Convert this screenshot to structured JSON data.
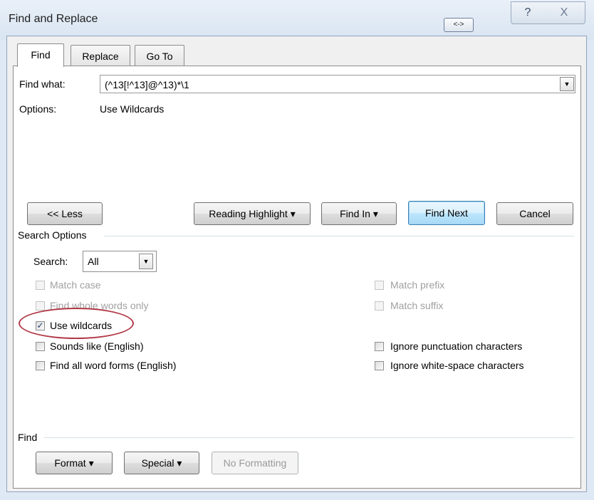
{
  "window": {
    "title": "Find and Replace",
    "keyboard_button": "<->",
    "help_icon": "?",
    "close_icon": "X"
  },
  "tabs": [
    {
      "label": "Find",
      "active": true
    },
    {
      "label": "Replace",
      "active": false
    },
    {
      "label": "Go To",
      "active": false
    }
  ],
  "find_what": {
    "label": "Find what:",
    "value": "(^13[!^13]@^13)*\\1"
  },
  "options_summary": {
    "label": "Options:",
    "value": "Use Wildcards"
  },
  "buttons": {
    "less": "<< Less",
    "reading_highlight": "Reading Highlight",
    "find_in": "Find In",
    "find_next": "Find Next",
    "cancel": "Cancel"
  },
  "search_options": {
    "header": "Search Options",
    "search_label": "Search:",
    "search_value": "All",
    "checkboxes_left": [
      {
        "label": "Match case",
        "checked": false,
        "enabled": false
      },
      {
        "label": "Find whole words only",
        "checked": false,
        "enabled": false
      },
      {
        "label": "Use wildcards",
        "checked": true,
        "enabled": true
      },
      {
        "label": "Sounds like (English)",
        "checked": false,
        "enabled": true
      },
      {
        "label": "Find all word forms (English)",
        "checked": false,
        "enabled": true
      }
    ],
    "checkboxes_right": [
      {
        "label": "Match prefix",
        "checked": false,
        "enabled": false
      },
      {
        "label": "Match suffix",
        "checked": false,
        "enabled": false
      },
      {
        "label": "Ignore punctuation characters",
        "checked": false,
        "enabled": true
      },
      {
        "label": "Ignore white-space characters",
        "checked": false,
        "enabled": true
      }
    ]
  },
  "find_group": {
    "header": "Find",
    "format": "Format",
    "special": "Special",
    "no_formatting": "No Formatting"
  },
  "colors": {
    "annotation": "#b23a48",
    "focus_border": "#3c7fb1"
  }
}
